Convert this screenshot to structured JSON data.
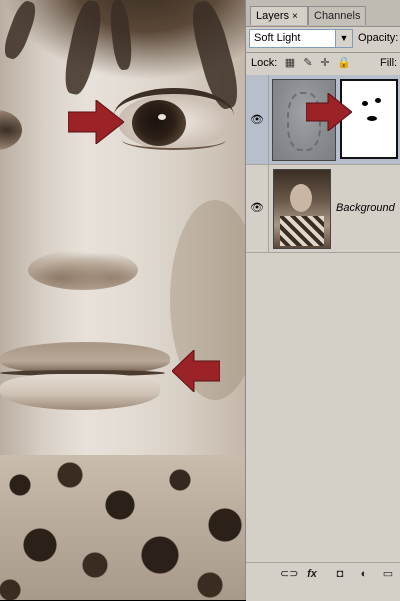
{
  "layers_panel": {
    "tabs": [
      {
        "label": "Layers",
        "close": "×"
      },
      {
        "label": "Channels"
      }
    ],
    "blend_mode": "Soft Light",
    "opacity_label": "Opacity:",
    "lock_label": "Lock:",
    "fill_label": "Fill:",
    "layers": [
      {
        "name": "",
        "visible": true,
        "has_mask": true,
        "selected": true
      },
      {
        "name": "Background",
        "visible": true,
        "has_mask": false,
        "selected": false
      }
    ],
    "bottom_icons": [
      "link-icon",
      "fx-icon",
      "add-mask-icon",
      "adjustment-icon",
      "folder-icon"
    ],
    "fx_label": "fx"
  },
  "colors": {
    "arrow_red": "#9b2226",
    "panel_bg": "#d4d0c8",
    "selected_layer_bg": "#b8bfcc"
  }
}
